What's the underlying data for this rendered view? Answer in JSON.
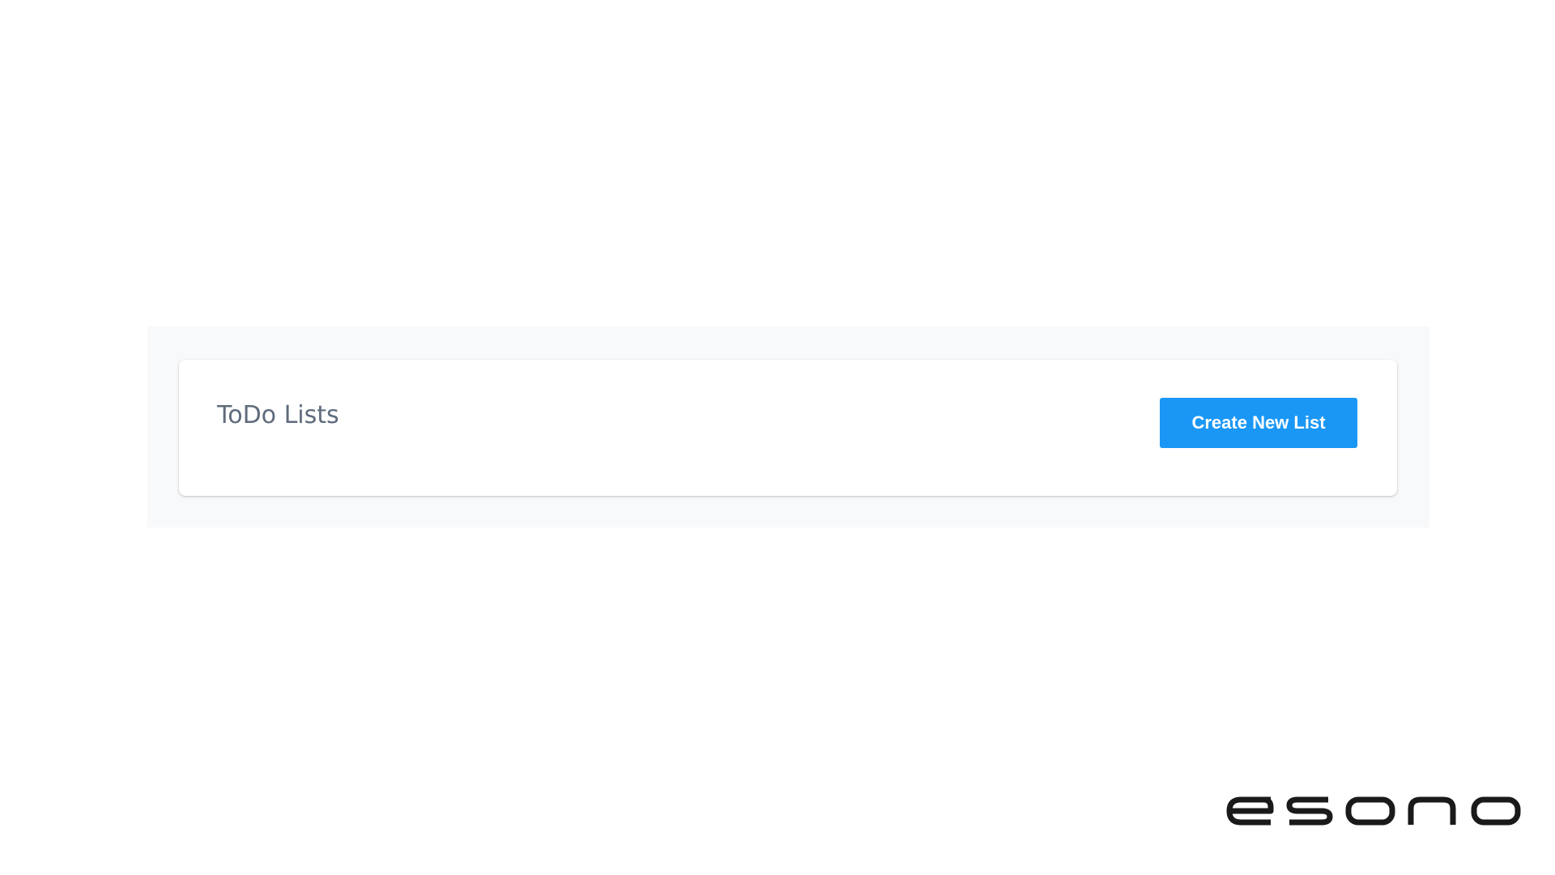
{
  "todo_panel": {
    "title": "ToDo Lists",
    "create_button_label": "Create New List"
  },
  "branding": {
    "logo_text": "esono"
  },
  "colors": {
    "accent": "#1a97f5",
    "title_text": "#5f6b7c",
    "panel_background": "#f8f9fa",
    "logo": "#1a1a1a"
  }
}
